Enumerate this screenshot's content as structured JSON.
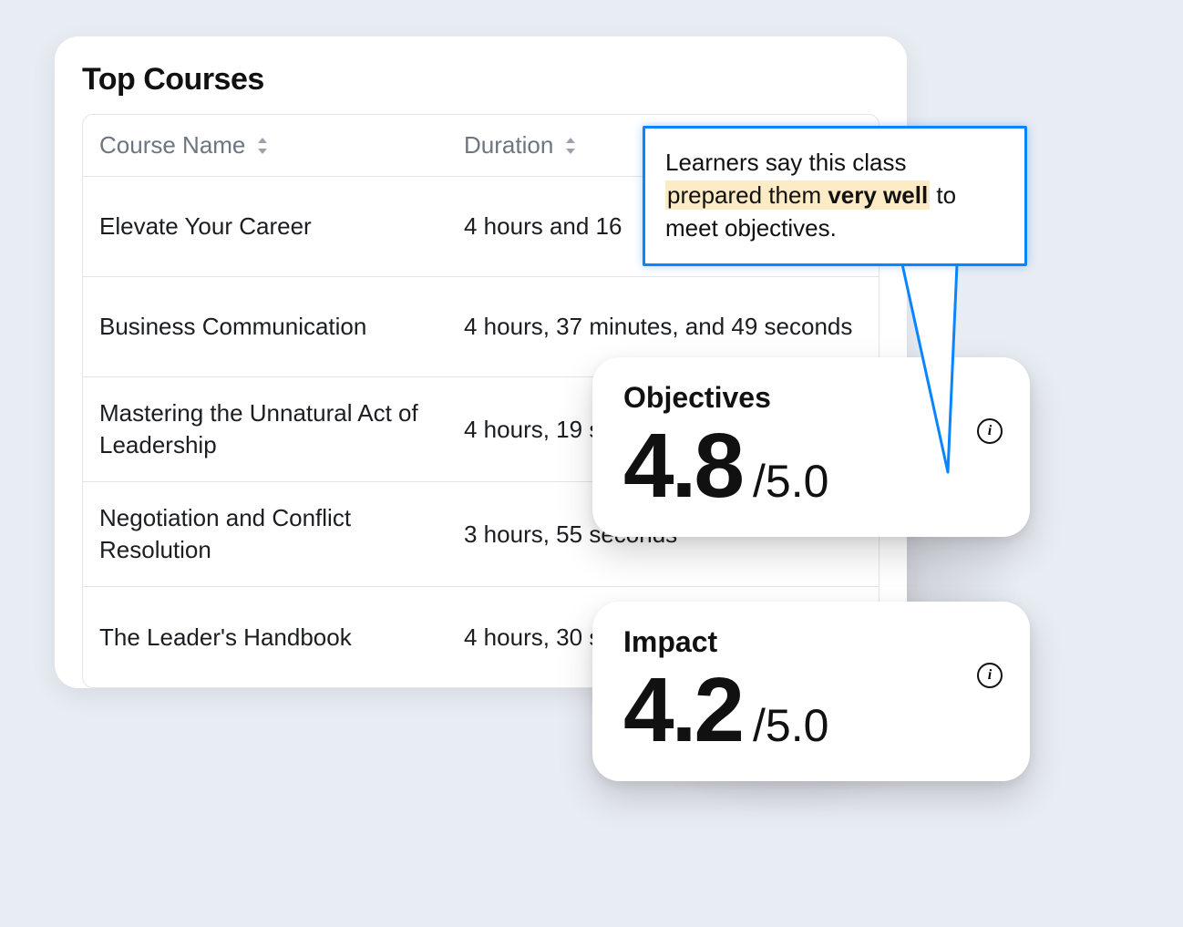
{
  "panel": {
    "title": "Top Courses",
    "columns": {
      "name": "Course Name",
      "duration": "Duration"
    },
    "rows": [
      {
        "name": "Elevate Your Career",
        "duration": "4 hours and 16"
      },
      {
        "name": "Business Communication",
        "duration": "4 hours, 37 minutes, and 49 seconds"
      },
      {
        "name": "Mastering the Unnatural Act of Leadership",
        "duration": "4 hours, 19 seconds"
      },
      {
        "name": "Negotiation and Conflict Resolution",
        "duration": "3 hours, 55 seconds"
      },
      {
        "name": "The Leader's Handbook",
        "duration": "4 hours, 30 seconds"
      }
    ]
  },
  "tooltip": {
    "line1": "Learners say this class ",
    "highlight_pre": "prepared them ",
    "highlight_bold": "very well",
    "line2_rest": " to meet objectives."
  },
  "metrics": {
    "objectives": {
      "label": "Objectives",
      "value": "4.8",
      "max": "/5.0"
    },
    "impact": {
      "label": "Impact",
      "value": "4.2",
      "max": "/5.0"
    }
  },
  "icons": {
    "info": "i"
  }
}
